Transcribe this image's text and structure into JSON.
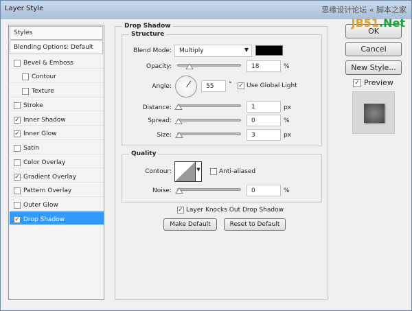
{
  "window": {
    "title": "Layer Style",
    "watermark_line1": "思缘设计论坛 « 脚本之家",
    "watermark_line2a": "JB51",
    ".": ".",
    "watermark_line2b": ".Net"
  },
  "sidebar": {
    "styles_header": "Styles",
    "blending": "Blending Options: Default",
    "items": [
      {
        "label": "Bevel & Emboss",
        "checked": false,
        "indent": false
      },
      {
        "label": "Contour",
        "checked": false,
        "indent": true
      },
      {
        "label": "Texture",
        "checked": false,
        "indent": true
      },
      {
        "label": "Stroke",
        "checked": false,
        "indent": false
      },
      {
        "label": "Inner Shadow",
        "checked": true,
        "indent": false
      },
      {
        "label": "Inner Glow",
        "checked": true,
        "indent": false
      },
      {
        "label": "Satin",
        "checked": false,
        "indent": false
      },
      {
        "label": "Color Overlay",
        "checked": false,
        "indent": false
      },
      {
        "label": "Gradient Overlay",
        "checked": true,
        "indent": false
      },
      {
        "label": "Pattern Overlay",
        "checked": false,
        "indent": false
      },
      {
        "label": "Outer Glow",
        "checked": false,
        "indent": false
      },
      {
        "label": "Drop Shadow",
        "checked": true,
        "indent": false,
        "selected": true
      }
    ]
  },
  "drop_shadow": {
    "title": "Drop Shadow",
    "structure": {
      "title": "Structure",
      "blend_mode_label": "Blend Mode:",
      "blend_mode": "Multiply",
      "color": "#000000",
      "opacity_label": "Opacity:",
      "opacity": "18",
      "opacity_unit": "%",
      "angle_label": "Angle:",
      "angle": "55",
      "angle_unit": "°",
      "global_light_label": "Use Global Light",
      "global_light": true,
      "distance_label": "Distance:",
      "distance": "1",
      "distance_unit": "px",
      "spread_label": "Spread:",
      "spread": "0",
      "spread_unit": "%",
      "size_label": "Size:",
      "size": "3",
      "size_unit": "px"
    },
    "quality": {
      "title": "Quality",
      "contour_label": "Contour:",
      "anti_aliased_label": "Anti-aliased",
      "anti_aliased": false,
      "noise_label": "Noise:",
      "noise": "0",
      "noise_unit": "%"
    },
    "knockout_label": "Layer Knocks Out Drop Shadow",
    "knockout": true,
    "make_default": "Make Default",
    "reset_default": "Reset to Default"
  },
  "buttons": {
    "ok": "OK",
    "cancel": "Cancel",
    "new_style": "New Style...",
    "preview_label": "Preview",
    "preview": true
  },
  "colors": {
    "selection": "#3399ff"
  }
}
